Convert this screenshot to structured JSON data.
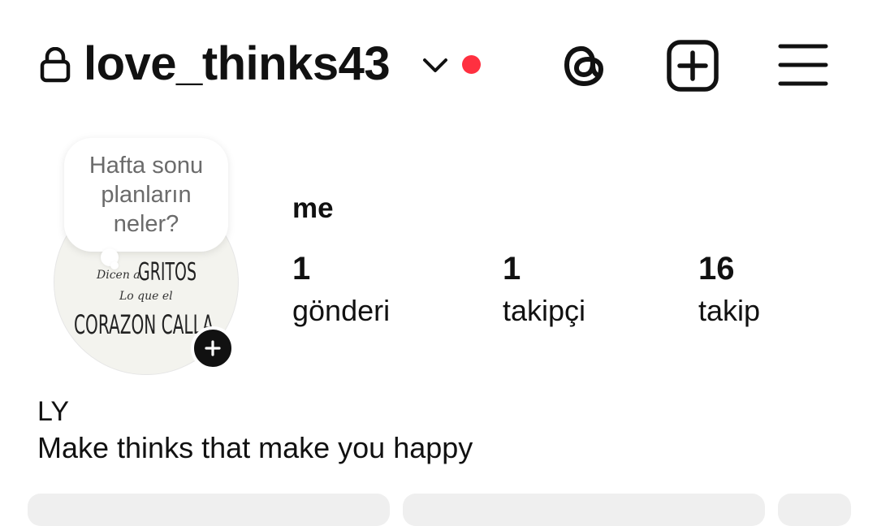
{
  "header": {
    "username": "love_thinks43",
    "icons": [
      "lock-icon",
      "chevron-down-icon",
      "notification-dot",
      "threads-icon",
      "create-icon",
      "menu-icon"
    ],
    "dot_color": "#ff3040"
  },
  "note": {
    "text": "Hafta sonu planların neler?"
  },
  "avatar": {
    "icon": "add-story-icon",
    "image_text": {
      "line1_small": "Dicen a",
      "line1_big": "GRITOS",
      "line2": "Lo que el",
      "line3": "CORAZON CALLA"
    }
  },
  "profile": {
    "display_name": "me"
  },
  "stats": {
    "posts": {
      "value": "1",
      "label": "gönderi"
    },
    "followers": {
      "value": "1",
      "label": "takipçi"
    },
    "following": {
      "value": "16",
      "label": "takip"
    }
  },
  "bio": {
    "name": "LY",
    "text": "Make thinks that make you happy"
  },
  "colors": {
    "text": "#111111",
    "muted": "#6b6b6b",
    "button_bg": "#efefef"
  }
}
